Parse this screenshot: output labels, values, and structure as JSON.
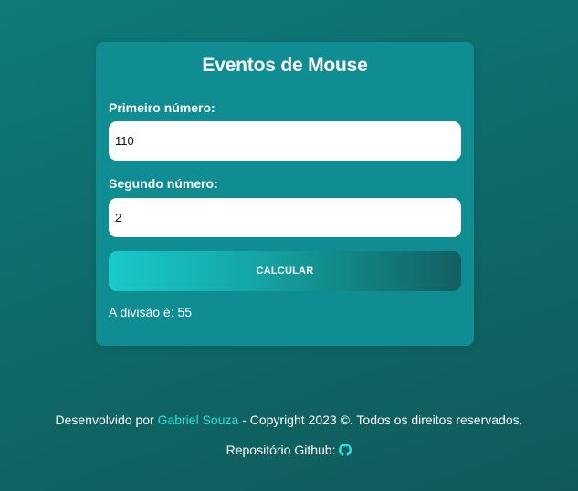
{
  "card": {
    "title": "Eventos de Mouse",
    "first_label": "Primeiro número:",
    "first_value": "110",
    "second_label": "Segundo número:",
    "second_value": "2",
    "button_label": "CALCULAR",
    "result": "A divisão é: 55"
  },
  "footer": {
    "prefix": "Desenvolvido por ",
    "author": "Gabriel Souza",
    "suffix": " - Copyright 2023 ©. Todos os direitos reservados.",
    "repo_label": "Repositório Github:",
    "github_icon": "github-icon"
  },
  "colors": {
    "background_start": "#0e7a7a",
    "background_end": "#0f5a59",
    "card": "#0f8d92",
    "link": "#2fe0e0",
    "button_start": "#19c9c9",
    "button_end": "#125f5f"
  }
}
